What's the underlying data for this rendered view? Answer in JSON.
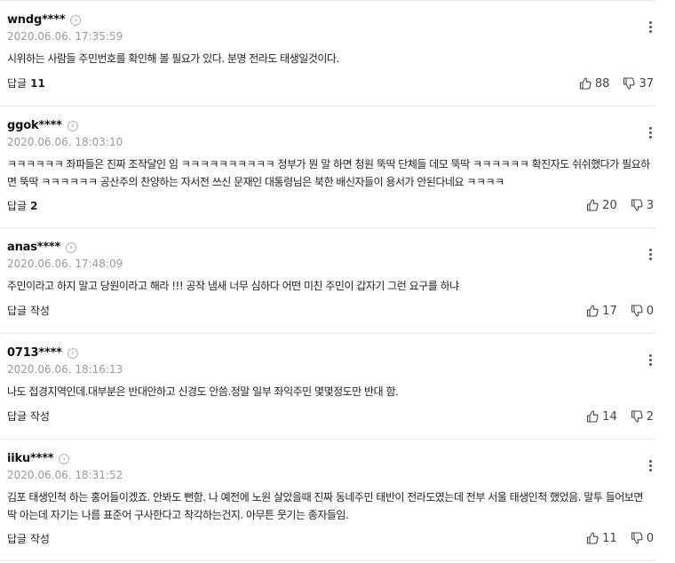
{
  "labels": {
    "reply_label": "답글"
  },
  "comments": [
    {
      "username": "wndg****",
      "date": "2020.06.06. 17:35:59",
      "text": "시위하는 사람들 주민번호를 확인해 볼 필요가 있다. 분명 전라도 태생일것이다.",
      "reply_text": "답글",
      "reply_count": "11",
      "likes": "88",
      "dislikes": "37"
    },
    {
      "username": "ggok****",
      "date": "2020.06.06. 18:03:10",
      "text": "ㅋㅋㅋㅋㅋㅋ 좌파들은 진짜 조작달인 임 ㅋㅋㅋㅋㅋㅋㅋㅋㅋㅋ 정부가 뭔 말 하면 청원 뚝딱 단체들 데모 뚝딱 ㅋㅋㅋㅋㅋㅋ 확진자도 쉬쉬했다가 필요하면 뚝딱 ㅋㅋㅋㅋㅋㅋ 공산주의 찬양하는 자서전 쓰신 문재인 대통령님은 북한 배신자들이 용서가 안된다네요 ㅋㅋㅋㅋ",
      "reply_text": "답글",
      "reply_count": "2",
      "likes": "20",
      "dislikes": "3"
    },
    {
      "username": "anas****",
      "date": "2020.06.06. 17:48:09",
      "text": "주민이라고 하지 말고 당원이라고 해라 !!! 공작 냄새 너무 심하다 어떤 미친 주민이 갑자기 그런 요구를 하냐",
      "reply_text": "답글 작성",
      "reply_count": "",
      "likes": "17",
      "dislikes": "0"
    },
    {
      "username": "0713****",
      "date": "2020.06.06. 18:16:13",
      "text": "나도 접경지역인데.대부분은 반대안하고 신경도 안씀.정말 일부 좌익주민 몇몇정도만 반대 함.",
      "reply_text": "답글 작성",
      "reply_count": "",
      "likes": "14",
      "dislikes": "2"
    },
    {
      "username": "iiku****",
      "date": "2020.06.06. 18:31:52",
      "text": "김포 태생인척 하는 홍어들이겠죠. 안봐도 뻔함. 나 예전에 노원 살았을때 진짜 동네주민 태반이 전라도였는데 전부 서울 태생인척 했었음. 말투 들어보면 딱 아는데 자기는 나름 표준어 구사한다고 착각하는건지. 아무튼 웃기는 종자들임.",
      "reply_text": "답글 작성",
      "reply_count": "",
      "likes": "11",
      "dislikes": "0"
    }
  ],
  "icons": {
    "profile": "chevron-right-icon",
    "more": "more-vertical-icon",
    "like": "thumbs-up-icon",
    "dislike": "thumbs-down-icon"
  },
  "colors": {
    "date": "#9a9a9a",
    "divider": "#e9e9e9"
  }
}
